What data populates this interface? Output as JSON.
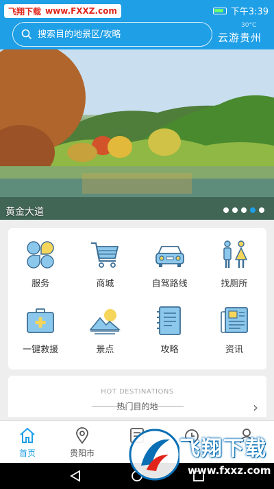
{
  "status_bar": {
    "watermark_brand": "飞翔下载",
    "watermark_url": "www.FXXZ.com",
    "time": "下午3:39"
  },
  "header": {
    "search_placeholder": "搜索目的地景区/攻略",
    "weather_temp": "30°C",
    "weather_city": "云游贵州"
  },
  "banner": {
    "caption": "黄金大道",
    "dots_total": 5,
    "active_dot": 4
  },
  "grid": [
    {
      "label": "服务",
      "icon": "service-icon"
    },
    {
      "label": "商城",
      "icon": "cart-icon"
    },
    {
      "label": "自驾路线",
      "icon": "car-icon"
    },
    {
      "label": "找厕所",
      "icon": "toilet-icon"
    },
    {
      "label": "一键救援",
      "icon": "first-aid-icon"
    },
    {
      "label": "景点",
      "icon": "landscape-icon"
    },
    {
      "label": "攻略",
      "icon": "notebook-icon"
    },
    {
      "label": "资讯",
      "icon": "newspaper-icon"
    }
  ],
  "hot": {
    "title_en": "HOT DESTINATIONS",
    "title_cn": "热门目的地"
  },
  "bottom_nav": [
    {
      "label": "首页",
      "icon": "home-icon",
      "active": true
    },
    {
      "label": "贵阳市",
      "icon": "location-icon",
      "active": false
    },
    {
      "label": "",
      "icon": "list-icon",
      "active": false
    },
    {
      "label": "",
      "icon": "history-icon",
      "active": false
    },
    {
      "label": "",
      "icon": "user-icon",
      "active": false
    }
  ],
  "watermark": {
    "title": "飞翔下载",
    "url": "www.fxxz.com"
  },
  "colors": {
    "primary": "#1e9fe6",
    "icon_blue": "#8cc8ec",
    "icon_yellow": "#f5d55a",
    "icon_outline": "#3c6f96"
  }
}
